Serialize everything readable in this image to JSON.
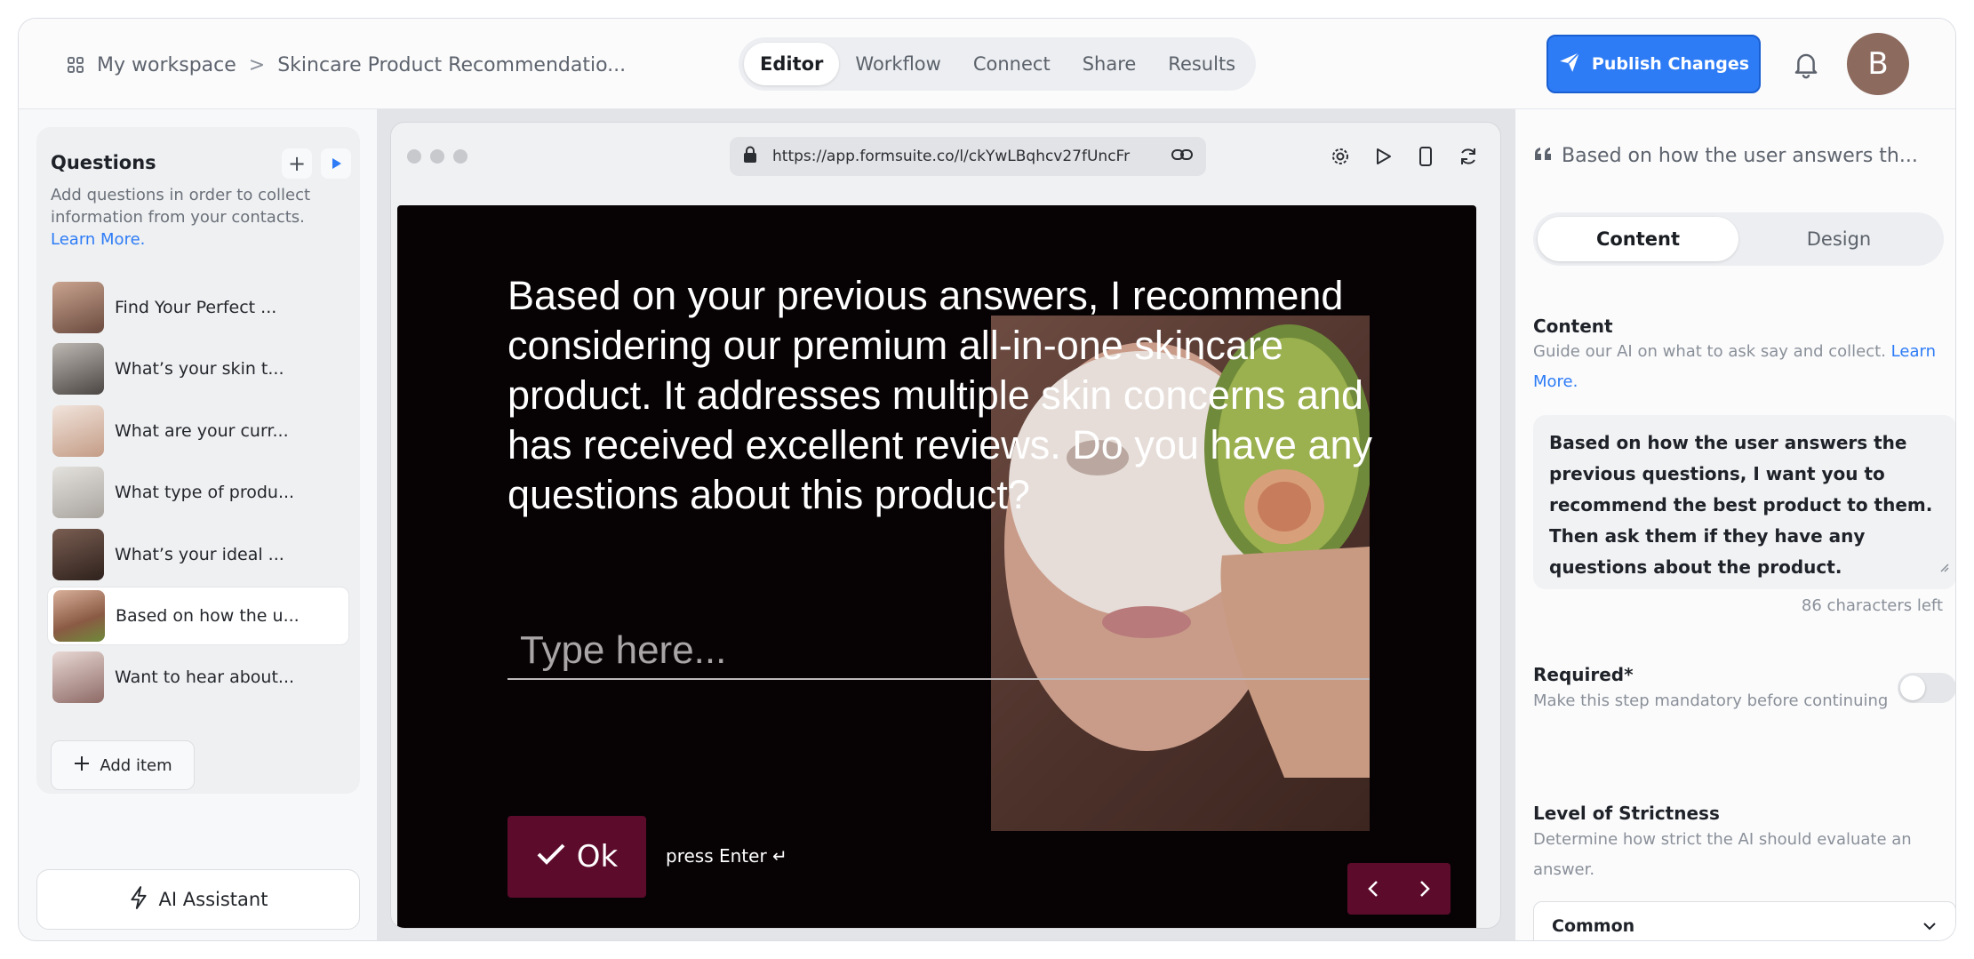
{
  "breadcrumb": {
    "workspace": "My workspace",
    "separator": ">",
    "form_name": "Skincare Product Recommendatio..."
  },
  "nav": {
    "tabs": [
      {
        "label": "Editor",
        "active": true
      },
      {
        "label": "Workflow",
        "active": false
      },
      {
        "label": "Connect",
        "active": false
      },
      {
        "label": "Share",
        "active": false
      },
      {
        "label": "Results",
        "active": false
      }
    ]
  },
  "header": {
    "publish_label": "Publish Changes",
    "avatar_initial": "B",
    "publish_color": "#2d7cf6"
  },
  "questions_panel": {
    "title": "Questions",
    "description": "Add questions in order to collect information from your contacts.",
    "learn_more": "Learn More.",
    "items": [
      {
        "label": "Find Your Perfect ...",
        "thumb": "#8a6a5c"
      },
      {
        "label": "What’s your skin t...",
        "thumb": "#6f6a66"
      },
      {
        "label": "What are your curr...",
        "thumb": "#d9c3b6"
      },
      {
        "label": "What type of produ...",
        "thumb": "#c9c7c3"
      },
      {
        "label": "What’s your ideal ...",
        "thumb": "#4e3a33"
      },
      {
        "label": "Based on how the u...",
        "thumb": "#a8765e",
        "active": true
      },
      {
        "label": "Want to hear about...",
        "thumb": "#b89a96"
      }
    ],
    "add_item_label": "Add item",
    "ai_assistant_label": "AI Assistant"
  },
  "preview": {
    "url": "https://app.formsuite.co/l/ckYwLBqhcv27fUncFr",
    "question_text": "Based on your previous answers, I recommend considering our premium all-in-one skincare product. It addresses multiple skin concerns and has received excellent reviews. Do you have any questions about this product?",
    "input_placeholder": "Type here...",
    "ok_label": "Ok",
    "press_enter_label": "press Enter ↵",
    "accent_color": "#5c0b2b"
  },
  "settings_panel": {
    "title": "Based on how the user answers th...",
    "tabs": [
      {
        "label": "Content",
        "active": true
      },
      {
        "label": "Design",
        "active": false
      }
    ],
    "content": {
      "label": "Content",
      "help": "Guide our AI on what to ask say and collect.",
      "learn_more": "Learn More.",
      "value": "Based on how the user answers the previous questions, I want you to recommend the best product to them. Then ask them if they have any questions about the product.",
      "chars_left": "86 characters left"
    },
    "required": {
      "label": "Required*",
      "help": "Make this step mandatory before continuing",
      "enabled": false
    },
    "strictness": {
      "label": "Level of Strictness",
      "help": "Determine how strict the AI should evaluate an answer.",
      "selected": "Common"
    }
  }
}
